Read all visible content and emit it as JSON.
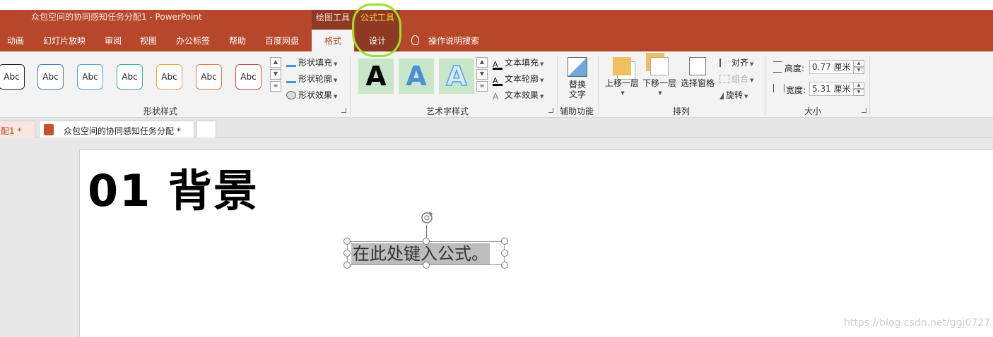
{
  "window": {
    "title": "众包空间的协同感知任务分配1  -  PowerPoint",
    "context_groups": [
      "绘图工具",
      "公式工具"
    ]
  },
  "tabs": [
    "动画",
    "幻灯片放映",
    "审阅",
    "视图",
    "办公标签",
    "帮助",
    "百度网盘",
    "格式",
    "设计"
  ],
  "tell_me": "操作说明搜索",
  "ribbon": {
    "shape_styles": {
      "label": "形状样式",
      "thumb_text": "Abc",
      "fill": "形状填充",
      "outline": "形状轮廓",
      "effects": "形状效果"
    },
    "wordart": {
      "label": "艺术字样式",
      "letter": "A",
      "text_fill": "文本填充",
      "text_outline": "文本轮廓",
      "text_effects": "文本效果"
    },
    "accessibility": {
      "label": "辅助功能",
      "alt_text_1": "替换",
      "alt_text_2": "文字"
    },
    "arrange": {
      "label": "排列",
      "bring_forward": "上移一层",
      "send_backward": "下移一层",
      "selection_pane": "选择窗格",
      "align": "对齐",
      "group": "组合",
      "rotate": "旋转"
    },
    "size": {
      "label": "大小",
      "height_label": "高度:",
      "height_value": "0.77 厘米",
      "width_label": "宽度:",
      "width_value": "5.31 厘米"
    }
  },
  "doc_tabs": [
    {
      "label": "配1 *"
    },
    {
      "label": "众包空间的协同感知任务分配 *"
    }
  ],
  "slide": {
    "title": "01  背景",
    "equation_placeholder": "在此处键入公式。"
  },
  "watermark": "https://blog.csdn.net/ggj0727",
  "colors": {
    "accent": "#b7472a",
    "highlight": "#9be02b"
  }
}
